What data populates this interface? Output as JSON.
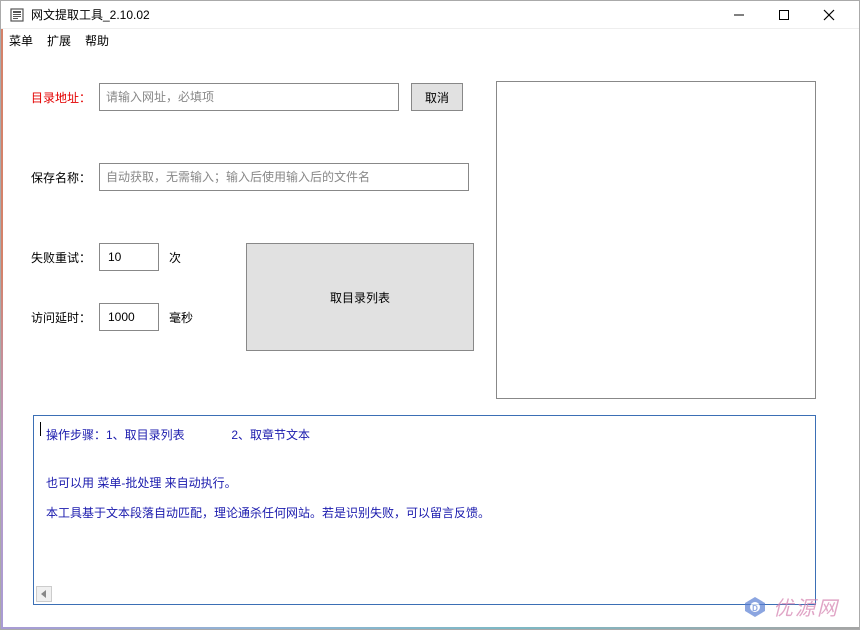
{
  "window": {
    "title": "网文提取工具_2.10.02"
  },
  "menubar": {
    "items": [
      "菜单",
      "扩展",
      "帮助"
    ]
  },
  "form": {
    "url_label": "目录地址：",
    "url_placeholder": "请输入网址，必填项",
    "cancel_label": "取消",
    "name_label": "保存名称：",
    "name_placeholder": "自动获取，无需输入；输入后使用输入后的文件名",
    "retry_label": "失败重试：",
    "retry_value": "10",
    "retry_unit": "次",
    "delay_label": "访问延时：",
    "delay_value": "1000",
    "delay_unit": "毫秒",
    "fetch_button": "取目录列表"
  },
  "info": {
    "line1a": "操作步骤：1、取目录列表",
    "line1b": "2、取章节文本",
    "line2": "也可以用 菜单-批处理 来自动执行。",
    "line3": "本工具基于文本段落自动匹配，理论通杀任何网站。若是识别失败，可以留言反馈。"
  },
  "watermark": {
    "text": "优源网"
  }
}
